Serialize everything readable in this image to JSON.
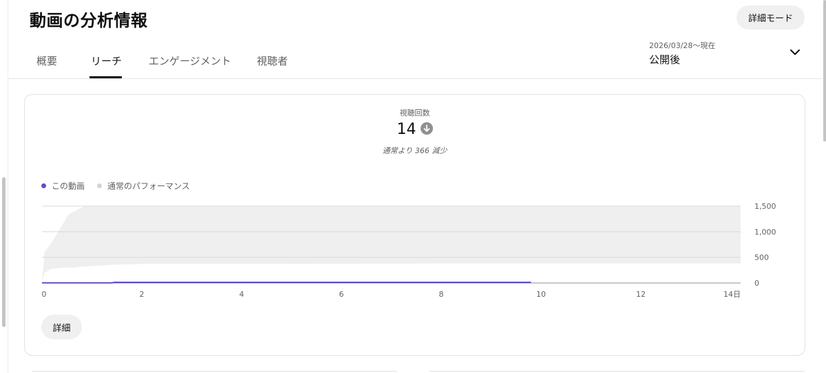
{
  "header": {
    "title": "動画の分析情報",
    "detail_mode_label": "詳細モード"
  },
  "tabs": [
    {
      "label": "概要",
      "active": false
    },
    {
      "label": "リーチ",
      "active": true
    },
    {
      "label": "エンゲージメント",
      "active": false
    },
    {
      "label": "視聴者",
      "active": false
    }
  ],
  "date_filter": {
    "range": "2026/03/28〜現在",
    "label": "公開後",
    "icon": "chevron-down-icon"
  },
  "metric": {
    "label": "視聴回数",
    "value": "14",
    "trend_icon": "arrow-down-circle-icon",
    "note": "通常より 366 減少"
  },
  "legend": [
    {
      "label": "この動画",
      "color": "#5b4fc7"
    },
    {
      "label": "通常のパフォーマンス",
      "color": "#d4d4d4"
    }
  ],
  "detail_button_label": "詳細",
  "colors": {
    "accent": "#5b4fc7",
    "band": "#efefef",
    "grid": "#d9d9d9"
  },
  "chart_data": {
    "type": "area",
    "xlabel": "",
    "ylabel": "",
    "x_ticks": [
      "0",
      "2",
      "4",
      "6",
      "8",
      "10",
      "12",
      "14日"
    ],
    "y_ticks": [
      "1,500",
      "1,000",
      "500",
      "0"
    ],
    "xlim": [
      0,
      14
    ],
    "ylim": [
      0,
      1500
    ],
    "grid": true,
    "legend": "top-left",
    "series": [
      {
        "name": "この動画",
        "x": [
          0,
          1.4,
          1.45,
          9.8
        ],
        "values": [
          4,
          4,
          14,
          14
        ]
      },
      {
        "name": "通常のパフォーマンス",
        "band": true,
        "x": [
          0,
          0.05,
          0.2,
          0.45,
          0.5,
          0.55,
          0.65,
          0.75,
          0.85,
          1.0,
          1.2,
          1.5,
          2.0,
          4.0,
          6.0,
          8.0,
          10.0,
          12.0,
          14.0
        ],
        "lower": [
          0,
          200,
          280,
          300,
          300,
          300,
          300,
          320,
          320,
          330,
          340,
          360,
          370,
          370,
          375,
          380,
          380,
          380,
          380
        ],
        "upper": [
          0,
          600,
          800,
          1200,
          1300,
          1350,
          1400,
          1450,
          1500,
          1500,
          1500,
          1500,
          1500,
          1500,
          1500,
          1500,
          1500,
          1500,
          1500
        ]
      }
    ]
  }
}
